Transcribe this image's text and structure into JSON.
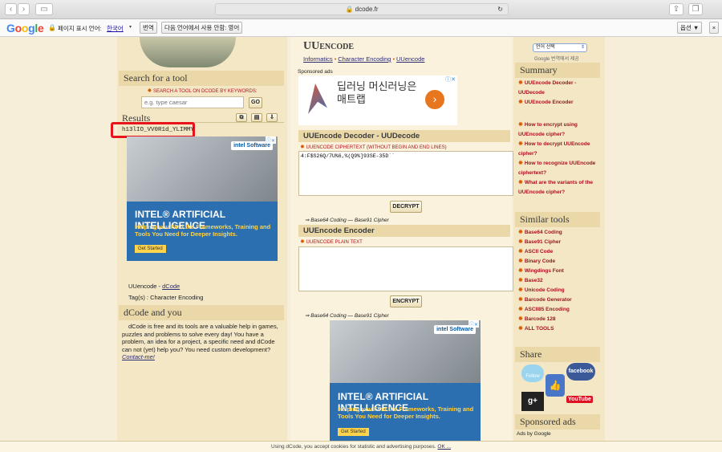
{
  "browser": {
    "address": "dcode.fr",
    "back_icon": "chevron-left",
    "forward_icon": "chevron-right",
    "sidebar_icon": "sidebar",
    "reload_icon": "reload"
  },
  "translate_bar": {
    "logo": "Google",
    "page_language_label": "페이지 표시 언어:",
    "language_value": "한국어",
    "translate_button": "번역",
    "next_language_text": "다음 언어에서 사용 안함: 영어",
    "options_button": "옵션 ▼",
    "close": "×"
  },
  "header": {
    "title": "UUencode",
    "breadcrumbs": [
      "Informatics",
      "Character Encoding",
      "UUencode"
    ],
    "sponsored_label": "Sponsored ads",
    "translate_select": "언어 선택",
    "powered_by": "Google 번역에서 제공"
  },
  "left": {
    "search_title": "Search for a tool",
    "search_label": "SEARCH A TOOL ON DCODE BY KEYWORDS:",
    "search_placeholder": "e.g. type caesar",
    "search_button": "GO",
    "results_title": "Results",
    "result_value": "h13lIO_VV0R1d_YLIMMY",
    "tool_label": "UUencode - ",
    "tool_link": "dCode",
    "tags": "Tag(s) : Character Encoding",
    "about_title": "dCode and you",
    "about_text": "dCode is free and its tools are a valuable help in games, puzzles and problems to solve every day! You have a problem, an idea for a project, a specific need and dCode can not (yet) help you? You need custom development? ",
    "about_contact": "Contact-me!"
  },
  "ads": {
    "left_title": "INTEL® ARTIFICIAL INTELLIGENCE",
    "left_sub": "Helping you Find the Frameworks, Training and Tools You Need for Deeper Insights.",
    "left_cta": "Get Started",
    "left_brand": "intel Software",
    "top_ad_text": "딥러닝 머신러닝은 매트랩",
    "bottom_title": "INTEL® ARTIFICIAL INTELLIGENCE",
    "bottom_sub": "Helping you Find the Frameworks, Training and Tools You Need for Deeper Insights.",
    "bottom_cta": "Get Started",
    "bottom_brand": "intel Software"
  },
  "decoder": {
    "title": "UUEncode Decoder - UUDecode",
    "label": "UUENCODE CIPHERTEXT (WITHOUT BEGIN AND END LINES)",
    "ciphertext": "4:F$S26Q/7U%6,%(Q9%]93SE-35D``",
    "button": "DECRYPT",
    "see_also": "⇒ Base64 Coding — Base91 Cipher"
  },
  "encoder": {
    "title": "UUEncode Encoder",
    "label": "UUENCODE PLAIN TEXT",
    "plaintext": "",
    "button": "ENCRYPT",
    "see_also": "⇒ Base64 Coding — Base91 Cipher"
  },
  "right": {
    "summary_title": "Summary",
    "summary_items": [
      "UUEncode Decoder - UUDecode",
      "UUEncode Encoder",
      "How to encrypt using UUEncode cipher?",
      "How to decrypt UUEncode cipher?",
      "How to recognize UUEncode ciphertext?",
      "What are the variants of the UUEncode cipher?"
    ],
    "similar_title": "Similar tools",
    "similar_items": [
      "Base64 Coding",
      "Base91 Cipher",
      "ASCII Code",
      "Binary Code",
      "Wingdings Font",
      "Base32",
      "Unicode Coding",
      "Barcode Generator",
      "ASCII85 Encoding",
      "Barcode 128",
      "ALL TOOLS"
    ],
    "share_title": "Share",
    "share_items": [
      "Follow",
      "facebook",
      "g+",
      "YouTube"
    ],
    "sponsored_title": "Sponsored ads",
    "ads_by": "Ads by Google"
  },
  "cookie": {
    "text": "Using dCode, you accept cookies for statistic and advertising purposes.",
    "ok": "OK ..."
  },
  "colors": {
    "highlight": "#e8141c",
    "section": "#ead8a9",
    "link_red": "#a8101a"
  }
}
